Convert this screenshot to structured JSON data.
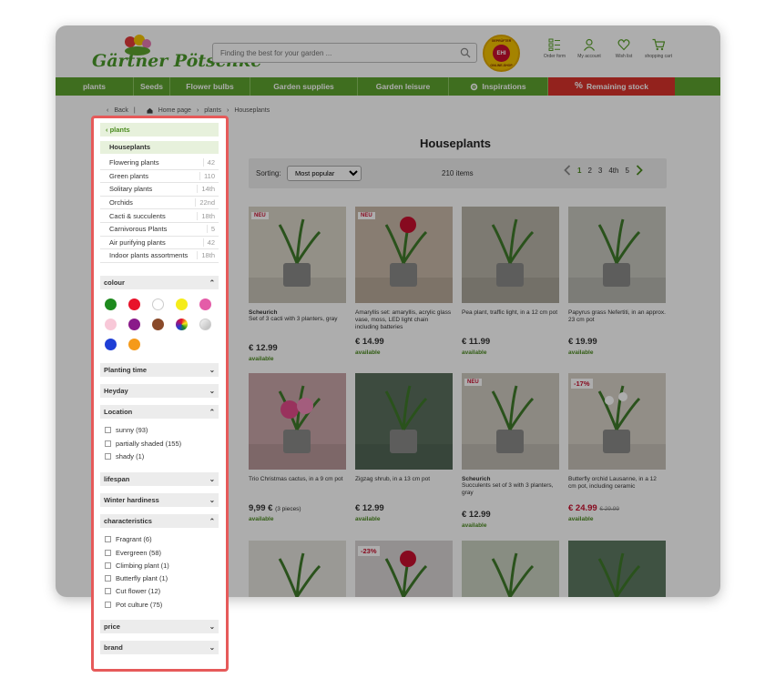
{
  "header": {
    "logo_text": "Gärtner Pötschke",
    "search_placeholder": "Finding the best for your garden ...",
    "ehi": {
      "top_text": "GEPRÜFTER",
      "center": "EHI",
      "bottom_text": "ONLINE-SHOP"
    },
    "icons": [
      {
        "label": "Order form",
        "icon": "order-form-icon"
      },
      {
        "label": "My account",
        "icon": "account-icon"
      },
      {
        "label": "Wish list",
        "icon": "heart-icon"
      },
      {
        "label": "shopping cart",
        "icon": "cart-icon"
      }
    ]
  },
  "nav": [
    "plants",
    "Seeds",
    "Flower bulbs",
    "Garden supplies",
    "Garden leisure",
    "Inspirations",
    "Remaining stock"
  ],
  "breadcrumb": {
    "back": "Back",
    "home": "Home page",
    "level1": "plants",
    "current": "Houseplants"
  },
  "sidebar": {
    "parent": "plants",
    "selected": "Houseplants",
    "categories": [
      {
        "name": "Flowering plants",
        "count": "42"
      },
      {
        "name": "Green plants",
        "count": "110"
      },
      {
        "name": "Solitary plants",
        "count": "14th"
      },
      {
        "name": "Orchids",
        "count": "22nd"
      },
      {
        "name": "Cacti & succulents",
        "count": "18th"
      },
      {
        "name": "Carnivorous Plants",
        "count": "5"
      },
      {
        "name": "Air purifying plants",
        "count": "42"
      },
      {
        "name": "Indoor plants assortments",
        "count": "18th"
      }
    ],
    "colour_label": "colour",
    "colours": [
      "#1e8a1e",
      "#e8132a",
      "#ffffff",
      "#f5ec1a",
      "#e45ca8",
      "#f8c8d8",
      "#8a1a8a",
      "#8a4a2a",
      "multi",
      "silver",
      "#1f3fd6",
      "#f59a1a"
    ],
    "planting_time": "Planting time",
    "heyday": "Heyday",
    "location_label": "Location",
    "location": [
      "sunny (93)",
      "partially shaded (155)",
      "shady (1)"
    ],
    "lifespan": "lifespan",
    "winter": "Winter hardiness",
    "characteristics_label": "characteristics",
    "characteristics": [
      "Fragrant (6)",
      "Evergreen (58)",
      "Climbing plant (1)",
      "Butterfly plant (1)",
      "Cut flower (12)",
      "Pot culture (75)"
    ],
    "price": "price",
    "brand": "brand"
  },
  "main": {
    "title": "Houseplants",
    "sort_label": "Sorting:",
    "sort_value": "Most popular",
    "items_count": "210 items",
    "pages": [
      "1",
      "2",
      "3",
      "4th",
      "5"
    ]
  },
  "products": [
    {
      "badge": "NEU",
      "brand": "Scheurich",
      "desc": "Set of 3 cacti with 3 planters, gray",
      "price": "€ 12.99",
      "avail": "available"
    },
    {
      "badge": "NEU",
      "brand": "",
      "desc": "Amaryllis set: amaryllis, acrylic glass vase, moss, LED light chain including batteries",
      "price": "€ 14.99",
      "avail": "available"
    },
    {
      "badge": "",
      "brand": "",
      "desc": "Pea plant, traffic light, in a 12 cm pot",
      "price": "€ 11.99",
      "avail": "available"
    },
    {
      "badge": "",
      "brand": "",
      "desc": "Papyrus grass Nefertiti, in an approx. 23 cm pot",
      "price": "€ 19.99",
      "avail": "available"
    },
    {
      "badge": "",
      "brand": "",
      "desc": "Trio Christmas cactus, in a 9 cm pot",
      "price": "9,99 €",
      "note": "(3 pieces)",
      "avail": "available"
    },
    {
      "badge": "",
      "brand": "",
      "desc": "Zigzag shrub, in a 13 cm pot",
      "price": "€ 12.99",
      "avail": "available"
    },
    {
      "badge": "NEU",
      "brand": "Scheurich",
      "desc": "Succulents set of 3 with 3 planters, gray",
      "price": "€ 12.99",
      "avail": "available"
    },
    {
      "badge": "-17%",
      "brand": "",
      "desc": "Butterfly orchid Lausanne, in a 12 cm pot, including ceramic",
      "price": "€ 24.99",
      "old": "€ 29.99",
      "avail": "available"
    },
    {
      "badge": "",
      "brand": "",
      "desc": "",
      "price": "",
      "avail": ""
    },
    {
      "badge": "-23%",
      "brand": "",
      "desc": "",
      "price": "",
      "avail": ""
    },
    {
      "badge": "",
      "brand": "",
      "desc": "",
      "price": "",
      "avail": ""
    },
    {
      "badge": "",
      "brand": "",
      "desc": "",
      "price": "",
      "avail": ""
    }
  ]
}
